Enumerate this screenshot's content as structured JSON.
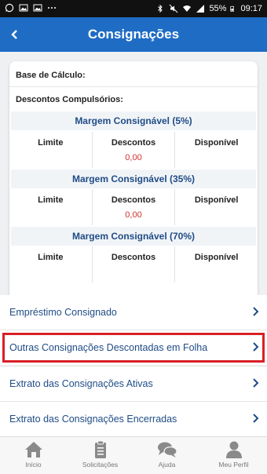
{
  "status_bar": {
    "battery": "55%",
    "time": "09:17"
  },
  "app_bar": {
    "title": "Consignações"
  },
  "card": {
    "base_label": "Base de Cálculo:",
    "descontos_label": "Descontos Compulsórios:",
    "margins": [
      {
        "title": "Margem Consignável (5%)",
        "col_limite": "Limite",
        "col_descontos": "Descontos",
        "col_disponivel": "Disponível",
        "descontos_value": "0,00"
      },
      {
        "title": "Margem Consignável (35%)",
        "col_limite": "Limite",
        "col_descontos": "Descontos",
        "col_disponivel": "Disponível",
        "descontos_value": "0,00"
      },
      {
        "title": "Margem Consignável (70%)",
        "col_limite": "Limite",
        "col_descontos": "Descontos",
        "col_disponivel": "Disponível",
        "descontos_value": ""
      }
    ]
  },
  "menu": {
    "items": [
      {
        "label": "Empréstimo Consignado"
      },
      {
        "label": "Outras Consignações Descontadas em Folha"
      },
      {
        "label": "Extrato das Consignações Ativas"
      },
      {
        "label": "Extrato das Consignações Encerradas"
      }
    ]
  },
  "bottom_nav": {
    "items": [
      {
        "label": "Início",
        "icon": "home-icon"
      },
      {
        "label": "Solicitações",
        "icon": "clipboard-icon"
      },
      {
        "label": "Ajuda",
        "icon": "chat-bubbles-icon"
      },
      {
        "label": "Meu Perfil",
        "icon": "user-icon"
      }
    ]
  },
  "colors": {
    "app_bar": "#1e6cc4",
    "link_text": "#1f4c86",
    "value_red": "#d0312d",
    "highlight_border": "#d81f26"
  }
}
